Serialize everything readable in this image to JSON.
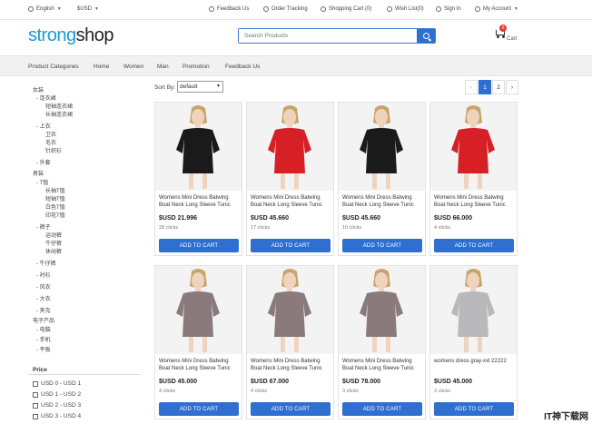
{
  "topbar": {
    "language": "English",
    "currency": "$USD",
    "feedback": "Feedback Us",
    "order_tracking": "Order Tracking",
    "cart": "Shopping Cart (0)",
    "wishlist": "Wish List(0)",
    "sign_in": "Sign In",
    "account": "My Account"
  },
  "logo": {
    "part1": "strong",
    "part2": "shop"
  },
  "search": {
    "placeholder": "Search Products"
  },
  "cart": {
    "count": "0",
    "label": "Cart"
  },
  "nav": {
    "items": [
      "Product Categories",
      "Home",
      "Women",
      "Man",
      "Promotion",
      "Feedback Us"
    ]
  },
  "sidebar": {
    "categories": [
      "女装",
      "连衣裙",
      "短袖连衣裙",
      "长袖连衣裙",
      "上衣",
      "卫衣",
      "毛衣",
      "针织衫",
      "外套",
      "男装",
      "T恤",
      "长袖T恤",
      "短袖T恤",
      "白色T恤",
      "印花T恤",
      "裤子",
      "运动裤",
      "牛仔裤",
      "休闲裤",
      "牛仔裤",
      "衬衫",
      "风衣",
      "大衣",
      "夹克",
      "电子产品",
      "电脑",
      "手机",
      "平板"
    ],
    "price_title": "Price",
    "price_options": [
      "USD 0 - USD 1",
      "USD 1 - USD 2",
      "USD 2 - USD 3",
      "USD 3 - USD 4"
    ]
  },
  "sort": {
    "label": "Sort By:",
    "value": "default"
  },
  "pagination": {
    "prev": "‹",
    "pages": [
      "1",
      "2"
    ],
    "next": "›"
  },
  "products": [
    {
      "title": "Womens Mini Dress Batwing Boat Neck Long Sleeve Tunic",
      "price": "$USD 21.996",
      "clicks": "28 clicks",
      "button": "ADD TO CART",
      "color": "#1a1a1a"
    },
    {
      "title": "Womens Mini Dress Batwing Boat Neck Long Sleeve Tunic",
      "price": "$USD 45.660",
      "clicks": "17 clicks",
      "button": "ADD TO CART",
      "color": "#d71f26"
    },
    {
      "title": "Womens Mini Dress Batwing Boat Neck Long Sleeve Tunic",
      "price": "$USD 45.660",
      "clicks": "10 clicks",
      "button": "ADD TO CART",
      "color": "#1a1a1a"
    },
    {
      "title": "Womens Mini Dress Batwing Boat Neck Long Sleeve Tunic",
      "price": "$USD 66.000",
      "clicks": "4 clicks",
      "button": "ADD TO CART",
      "color": "#d71f26"
    },
    {
      "title": "Womens Mini Dress Batwing Boat Neck Long Sleeve Tunic",
      "price": "$USD 45.000",
      "clicks": "4 clicks",
      "button": "ADD TO CART",
      "color": "#8a7a7c"
    },
    {
      "title": "Womens Mini Dress Batwing Boat Neck Long Sleeve Tunic",
      "price": "$USD 67.000",
      "clicks": "4 clicks",
      "button": "ADD TO CART",
      "color": "#8a7a7c"
    },
    {
      "title": "Womens Mini Dress Batwing Boat Neck Long Sleeve Tunic",
      "price": "$USD 78.000",
      "clicks": "3 clicks",
      "button": "ADD TO CART",
      "color": "#8a7a7c"
    },
    {
      "title": "womens dress gray-xxl 22222",
      "price": "$USD 45.000",
      "clicks": "3 clicks",
      "button": "ADD TO CART",
      "color": "#b9b9bb"
    }
  ],
  "watermark": {
    "text": "IT神下载网"
  }
}
